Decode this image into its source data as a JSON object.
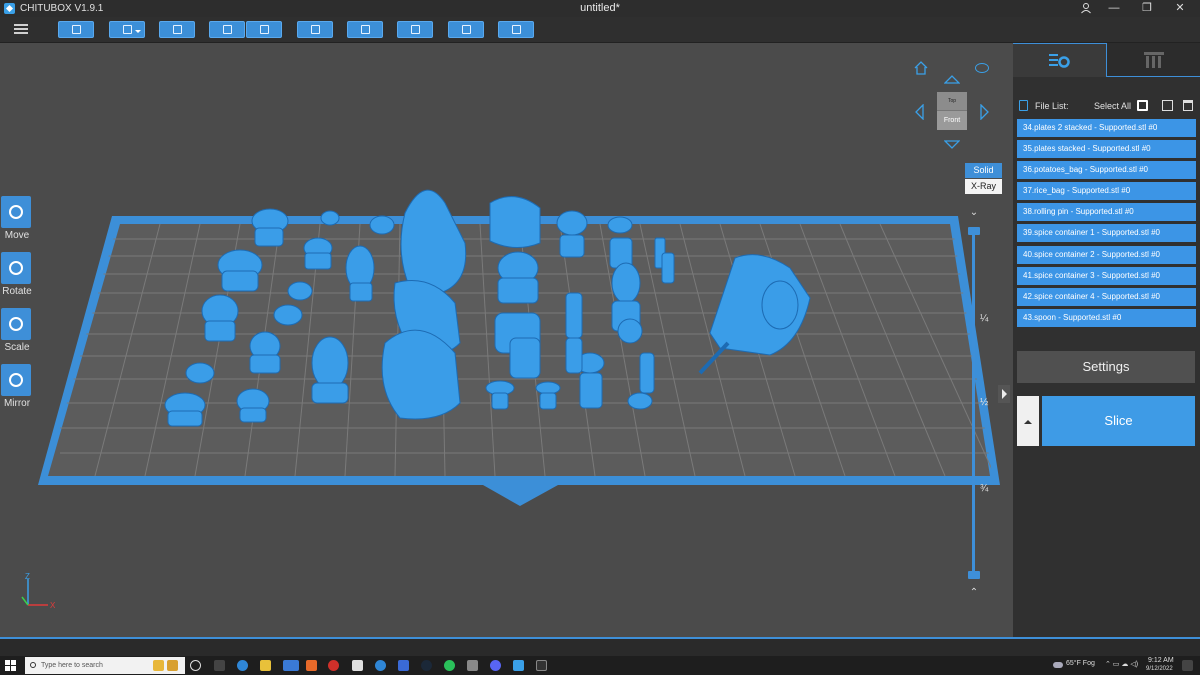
{
  "window": {
    "app_name": "CHITUBOX V1.9.1",
    "doc_title": "untitled*"
  },
  "colors": {
    "accent": "#3e8fd8",
    "model": "#3a9de8",
    "viewport_bg": "#4b4b4b",
    "panel_bg": "#303030"
  },
  "toolbar": {
    "items": [
      {
        "name": "open-file-icon"
      },
      {
        "name": "save-icon",
        "has_dropdown": true
      },
      {
        "name": "auto-layout-icon"
      },
      {
        "name": "undo-icon"
      },
      {
        "name": "redo-icon"
      },
      {
        "name": "copy-icon"
      },
      {
        "name": "support-icon"
      },
      {
        "name": "hollow-icon"
      },
      {
        "name": "drill-icon"
      },
      {
        "name": "mirror-icon"
      }
    ]
  },
  "left_tools": [
    {
      "label": "Move",
      "icon": "move-icon"
    },
    {
      "label": "Rotate",
      "icon": "rotate-icon"
    },
    {
      "label": "Scale",
      "icon": "scale-icon"
    },
    {
      "label": "Mirror",
      "icon": "mirror-icon"
    }
  ],
  "view_cube": {
    "top_label": "Top",
    "front_label": "Front"
  },
  "render_mode": {
    "solid_label": "Solid",
    "xray_label": "X-Ray",
    "selected": "Solid"
  },
  "layer_slider": {
    "ticks": [
      "¼",
      "½",
      "¾"
    ]
  },
  "axis": {
    "z_label": "Z",
    "x_label": "X"
  },
  "right_panel": {
    "tabs": [
      {
        "name": "settings-tab-icon",
        "active": true
      },
      {
        "name": "printer-tab-icon",
        "active": false
      }
    ],
    "file_list_label": "File List:",
    "select_all_label": "Select All",
    "files": [
      "34.plates 2 stacked - Supported.stl #0",
      "35.plates stacked - Supported.stl #0",
      "36.potatoes_bag - Supported.stl #0",
      "37.rice_bag - Supported.stl #0",
      "38.rolling pin - Supported.stl #0",
      "39.spice container 1 - Supported.stl #0",
      "40.spice container 2 - Supported.stl #0",
      "41.spice container 3 - Supported.stl #0",
      "42.spice container 4 - Supported.stl #0",
      "43.spoon - Supported.stl #0"
    ],
    "settings_label": "Settings",
    "slice_label": "Slice"
  },
  "taskbar": {
    "search_placeholder": "Type here to search",
    "weather": "65°F Fog",
    "time": "9:12 AM",
    "date": "9/12/2022"
  }
}
